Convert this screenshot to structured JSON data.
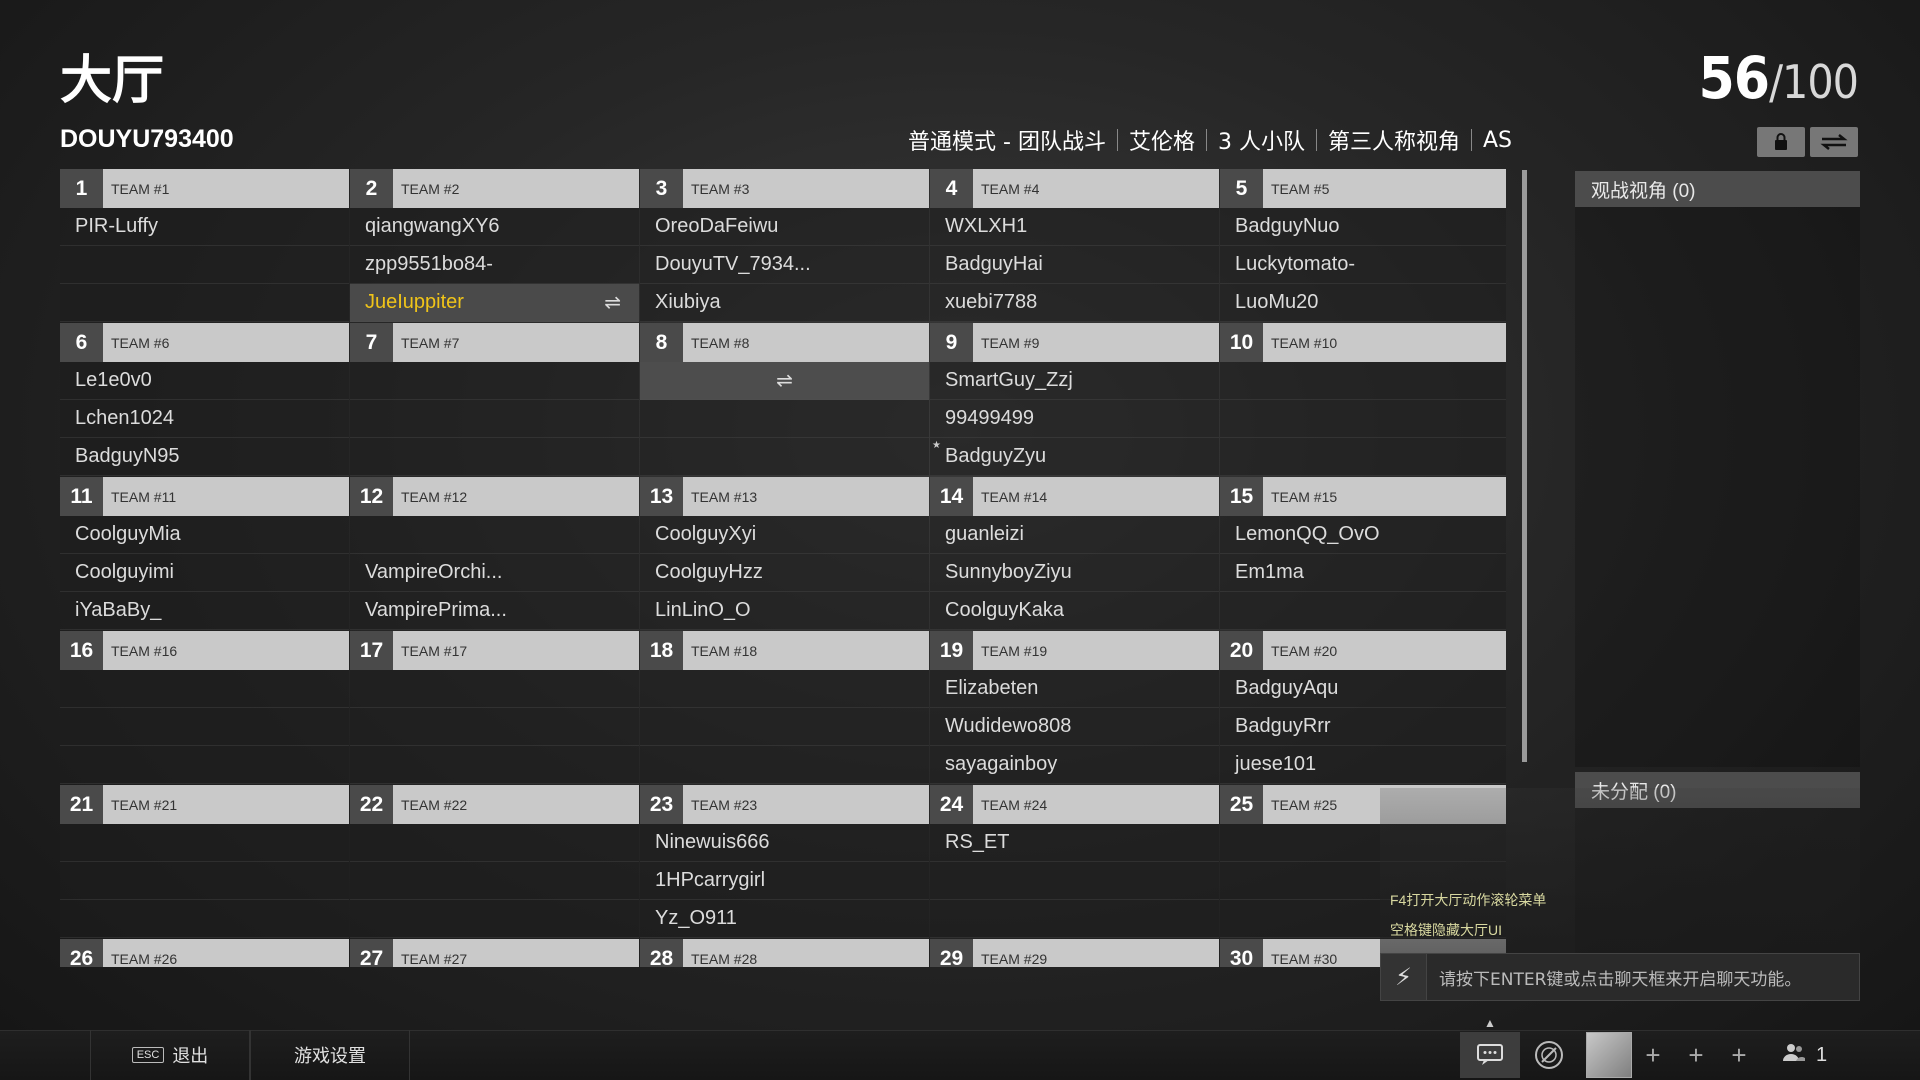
{
  "header": {
    "title": "大厅",
    "count_current": "56",
    "count_max": "/100",
    "room_id": "DOUYU793400"
  },
  "mode_bar": [
    "普通模式 - 团队战斗",
    "艾伦格",
    "3 人小队",
    "第三人称视角",
    "AS"
  ],
  "teams": [
    {
      "num": "1",
      "name": "TEAM #1",
      "players": [
        "PIR-Luffy",
        "",
        ""
      ]
    },
    {
      "num": "2",
      "name": "TEAM #2",
      "players": [
        "qiangwangXY6",
        "zpp9551bo84-",
        "JueIuppiter"
      ],
      "me_index": 2
    },
    {
      "num": "3",
      "name": "TEAM #3",
      "players": [
        "OreoDaFeiwu",
        "DouyuTV_7934...",
        "Xiubiya"
      ]
    },
    {
      "num": "4",
      "name": "TEAM #4",
      "players": [
        "WXLXH1",
        "BadguyHai",
        "xuebi7788"
      ]
    },
    {
      "num": "5",
      "name": "TEAM #5",
      "players": [
        "BadguyNuo",
        "Luckytomato-",
        "LuoMu20"
      ]
    },
    {
      "num": "6",
      "name": "TEAM #6",
      "players": [
        "Le1e0v0",
        "Lchen1024",
        "BadguyN95"
      ]
    },
    {
      "num": "7",
      "name": "TEAM #7",
      "players": [
        "",
        "",
        ""
      ]
    },
    {
      "num": "8",
      "name": "TEAM #8",
      "players": [
        "",
        "",
        ""
      ],
      "swap_index": 0
    },
    {
      "num": "9",
      "name": "TEAM #9",
      "players": [
        "SmartGuy_Zzj",
        "99499499",
        "BadguyZyu"
      ]
    },
    {
      "num": "10",
      "name": "TEAM #10",
      "players": [
        "",
        "",
        ""
      ]
    },
    {
      "num": "11",
      "name": "TEAM #11",
      "players": [
        "CoolguyMia",
        "Coolguyimi",
        "iYaBaBy_"
      ]
    },
    {
      "num": "12",
      "name": "TEAM #12",
      "players": [
        "",
        "VampireOrchi...",
        "VampirePrima..."
      ]
    },
    {
      "num": "13",
      "name": "TEAM #13",
      "players": [
        "CoolguyXyi",
        "CoolguyHzz",
        "LinLinO_O"
      ]
    },
    {
      "num": "14",
      "name": "TEAM #14",
      "players": [
        "guanleizi",
        "SunnyboyZiyu",
        "CoolguyKaka"
      ]
    },
    {
      "num": "15",
      "name": "TEAM #15",
      "players": [
        "LemonQQ_OvO",
        "Em1ma",
        ""
      ]
    },
    {
      "num": "16",
      "name": "TEAM #16",
      "players": [
        "",
        "",
        ""
      ]
    },
    {
      "num": "17",
      "name": "TEAM #17",
      "players": [
        "",
        "",
        ""
      ]
    },
    {
      "num": "18",
      "name": "TEAM #18",
      "players": [
        "",
        "",
        ""
      ]
    },
    {
      "num": "19",
      "name": "TEAM #19",
      "players": [
        "Elizabeten",
        "Wudidewo808",
        "sayagainboy"
      ]
    },
    {
      "num": "20",
      "name": "TEAM #20",
      "players": [
        "BadguyAqu",
        "BadguyRrr",
        "juese101"
      ]
    },
    {
      "num": "21",
      "name": "TEAM #21",
      "players": [
        "",
        "",
        ""
      ]
    },
    {
      "num": "22",
      "name": "TEAM #22",
      "players": [
        "",
        "",
        ""
      ]
    },
    {
      "num": "23",
      "name": "TEAM #23",
      "players": [
        "Ninewuis666",
        "1HPcarrygirl",
        "Yz_O911"
      ]
    },
    {
      "num": "24",
      "name": "TEAM #24",
      "players": [
        "RS_ET",
        "",
        ""
      ]
    },
    {
      "num": "25",
      "name": "TEAM #25",
      "players": [
        "",
        "",
        ""
      ]
    },
    {
      "num": "26",
      "name": "TEAM #26",
      "players": [
        "",
        "",
        ""
      ]
    },
    {
      "num": "27",
      "name": "TEAM #27",
      "players": [
        "",
        "",
        ""
      ]
    },
    {
      "num": "28",
      "name": "TEAM #28",
      "players": [
        "",
        "",
        ""
      ]
    },
    {
      "num": "29",
      "name": "TEAM #29",
      "players": [
        "",
        "",
        ""
      ]
    },
    {
      "num": "30",
      "name": "TEAM #30",
      "players": [
        "",
        "",
        ""
      ]
    }
  ],
  "side": {
    "spectator_label": "观战视角 (0)",
    "unassigned_label": "未分配 (0)"
  },
  "hints": {
    "line1": "F4打开大厅动作滚轮菜单",
    "line2": "空格键隐藏大厅UI"
  },
  "chat": {
    "placeholder": "请按下ENTER键或点击聊天框来开启聊天功能。"
  },
  "bottom": {
    "esc_key": "ESC",
    "exit_label": "退出",
    "settings_label": "游戏设置",
    "party_count": "1"
  },
  "icons": {
    "lock": "lock-icon",
    "swap": "swap-icon",
    "bolt": "lightning-icon",
    "chat": "chat-icon",
    "emblem": "emblem-icon",
    "plus": "plus-icon",
    "party": "party-icon"
  },
  "colors": {
    "self_highlight": "#f0c419",
    "team_header_bg": "#c9c9c9",
    "team_num_bg": "#4a4a4a"
  }
}
